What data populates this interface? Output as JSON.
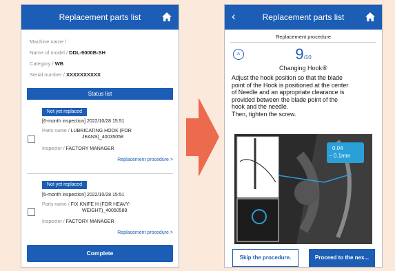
{
  "left_screen": {
    "header": {
      "title": "Replacement parts list"
    },
    "info": {
      "machine_name_label": "Machine name /",
      "model_label": "Name of model /",
      "model_value": "DDL-9000B-SH",
      "category_label": "Category /",
      "category_value": "WB",
      "serial_label": "Serial number /",
      "serial_value": "XXXXXXXXXX"
    },
    "status_list_label": "Status list",
    "items": [
      {
        "badge": "Not yet replaced",
        "inspection": "[6-month inspection] 2022/10/28 15:51",
        "parts_label": "Parts name /",
        "parts_line1": "LUBRICATING HOOK (FOR",
        "parts_line2": "JEANS)_40035058",
        "inspector_label": "Inspector /",
        "inspector_value": "FACTORY MANAGER",
        "link": "Replacement procedure"
      },
      {
        "badge": "Not yet replaced",
        "inspection": "[6-month inspection] 2022/10/28 15:51",
        "parts_label": "Parts name /",
        "parts_line1": "FIX KNIFE H (FOR HEAVY-",
        "parts_line2": "WEIGHT)_40050589",
        "inspector_label": "Inspector /",
        "inspector_value": "FACTORY MANAGER",
        "link": "Replacement procedure"
      }
    ],
    "complete_button": "Complete"
  },
  "right_screen": {
    "header": {
      "title": "Replacement parts list"
    },
    "procedure_label": "Replacement procedure",
    "step_number": "9",
    "step_total": "/10",
    "step_icon_text": "A",
    "step_name": "Changing Hook⑧",
    "instruction": [
      "Adjust the hook position so that the blade",
      "point of the Hook is positioned at the center",
      "of Needle and an appropriate clearance is",
      "provided between the blade point of the",
      "hook and the needle.",
      "Then, tighten the screw."
    ],
    "callout_line1": "0.04",
    "callout_line2": "~ 0.1mm",
    "skip_button": "Skip the procedure.",
    "proceed_button": "Proceed to the nex..."
  },
  "colors": {
    "accent": "#1c5db5",
    "arrow": "#ec6a4e",
    "background": "#fbe9dc"
  },
  "icons": [
    "home-icon",
    "back-icon",
    "chevron-right-icon",
    "checkbox"
  ]
}
